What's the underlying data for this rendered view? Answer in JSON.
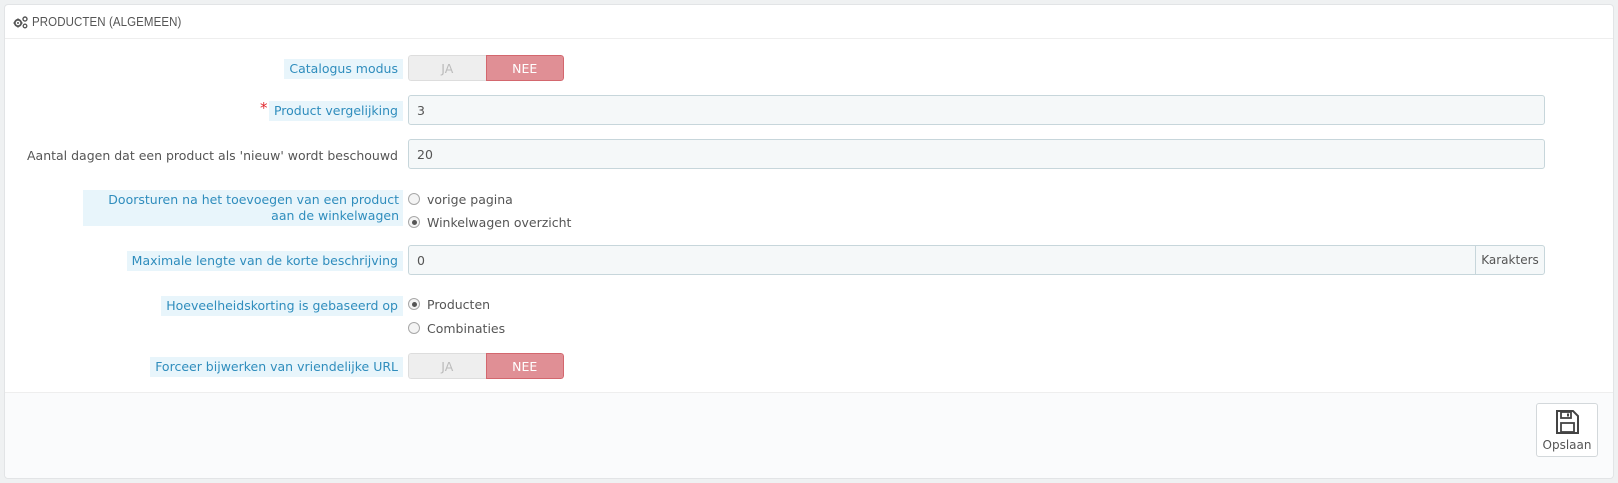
{
  "panel": {
    "title": "PRODUCTEN (ALGEMEEN)",
    "icon": "cogs-icon"
  },
  "fields": {
    "catalog_mode": {
      "label": "Catalogus modus",
      "yes": "JA",
      "no": "NEE",
      "value": "NEE"
    },
    "product_comparison": {
      "required_mark": "*",
      "label": "Product vergelijking",
      "value": "3"
    },
    "new_days": {
      "label": "Aantal dagen dat een product als 'nieuw' wordt beschouwd",
      "value": "20"
    },
    "redirect_after_add": {
      "label": "Doorsturen na het toevoegen van een product aan de winkelwagen",
      "options": [
        {
          "label": "vorige pagina",
          "checked": false
        },
        {
          "label": "Winkelwagen overzicht",
          "checked": true
        }
      ]
    },
    "short_desc_max": {
      "label": "Maximale lengte van de korte beschrijving",
      "value": "0",
      "addon": "Karakters"
    },
    "quantity_discount": {
      "label": "Hoeveelheidskorting is gebaseerd op",
      "options": [
        {
          "label": "Producten",
          "checked": true
        },
        {
          "label": "Combinaties",
          "checked": false
        }
      ]
    },
    "force_friendly_url": {
      "label": "Forceer bijwerken van vriendelijke URL",
      "yes": "JA",
      "no": "NEE",
      "value": "NEE"
    }
  },
  "footer": {
    "save_label": "Opslaan",
    "save_icon": "save-icon"
  },
  "colors": {
    "label_bg": "#e8f5fb",
    "label_text": "#2f8dbd",
    "toggle_active": "#e08f95",
    "required": "#e0282e"
  }
}
